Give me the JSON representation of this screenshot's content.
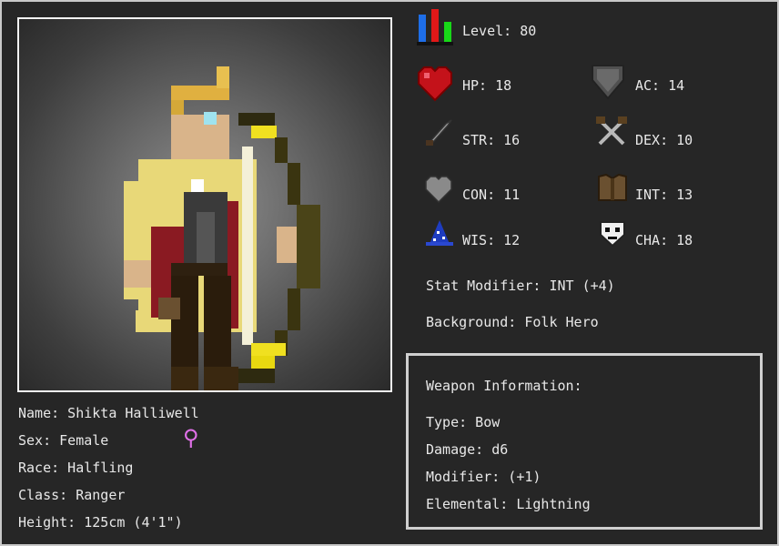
{
  "character": {
    "name": "Name: Shikta Halliwell",
    "sex": "Sex: Female",
    "sex_symbol": "⚲",
    "race": "Race: Halfling",
    "class": "Class: Ranger",
    "height": "Height: 125cm (4'1\")"
  },
  "stats": {
    "level": "Level: 80",
    "hp": "HP: 18",
    "ac": "AC: 14",
    "str": "STR: 16",
    "dex": "DEX: 10",
    "con": "CON: 11",
    "int": "INT: 13",
    "wis": "WIS: 12",
    "cha": "CHA: 18",
    "stat_modifier": "Stat Modifier: INT (+4)",
    "background": "Background: Folk Hero"
  },
  "weapon": {
    "heading": "Weapon Information:",
    "type": "Type: Bow",
    "damage": "Damage: d6",
    "modifier": "Modifier: (+1)",
    "elemental": "Elemental: Lightning"
  },
  "icons": {
    "level": "level-bars-icon",
    "hp": "heart-icon",
    "ac": "shield-icon",
    "str": "sword-icon",
    "dex": "crossed-daggers-icon",
    "con": "grey-heart-icon",
    "int": "leather-armor-icon",
    "wis": "wizard-hat-icon",
    "cha": "mask-icon"
  },
  "colors": {
    "background": "#262626",
    "text": "#e8e8e8",
    "heart": "#c4121a",
    "sex_symbol": "#e070e8",
    "lightning": "#f2e600"
  }
}
